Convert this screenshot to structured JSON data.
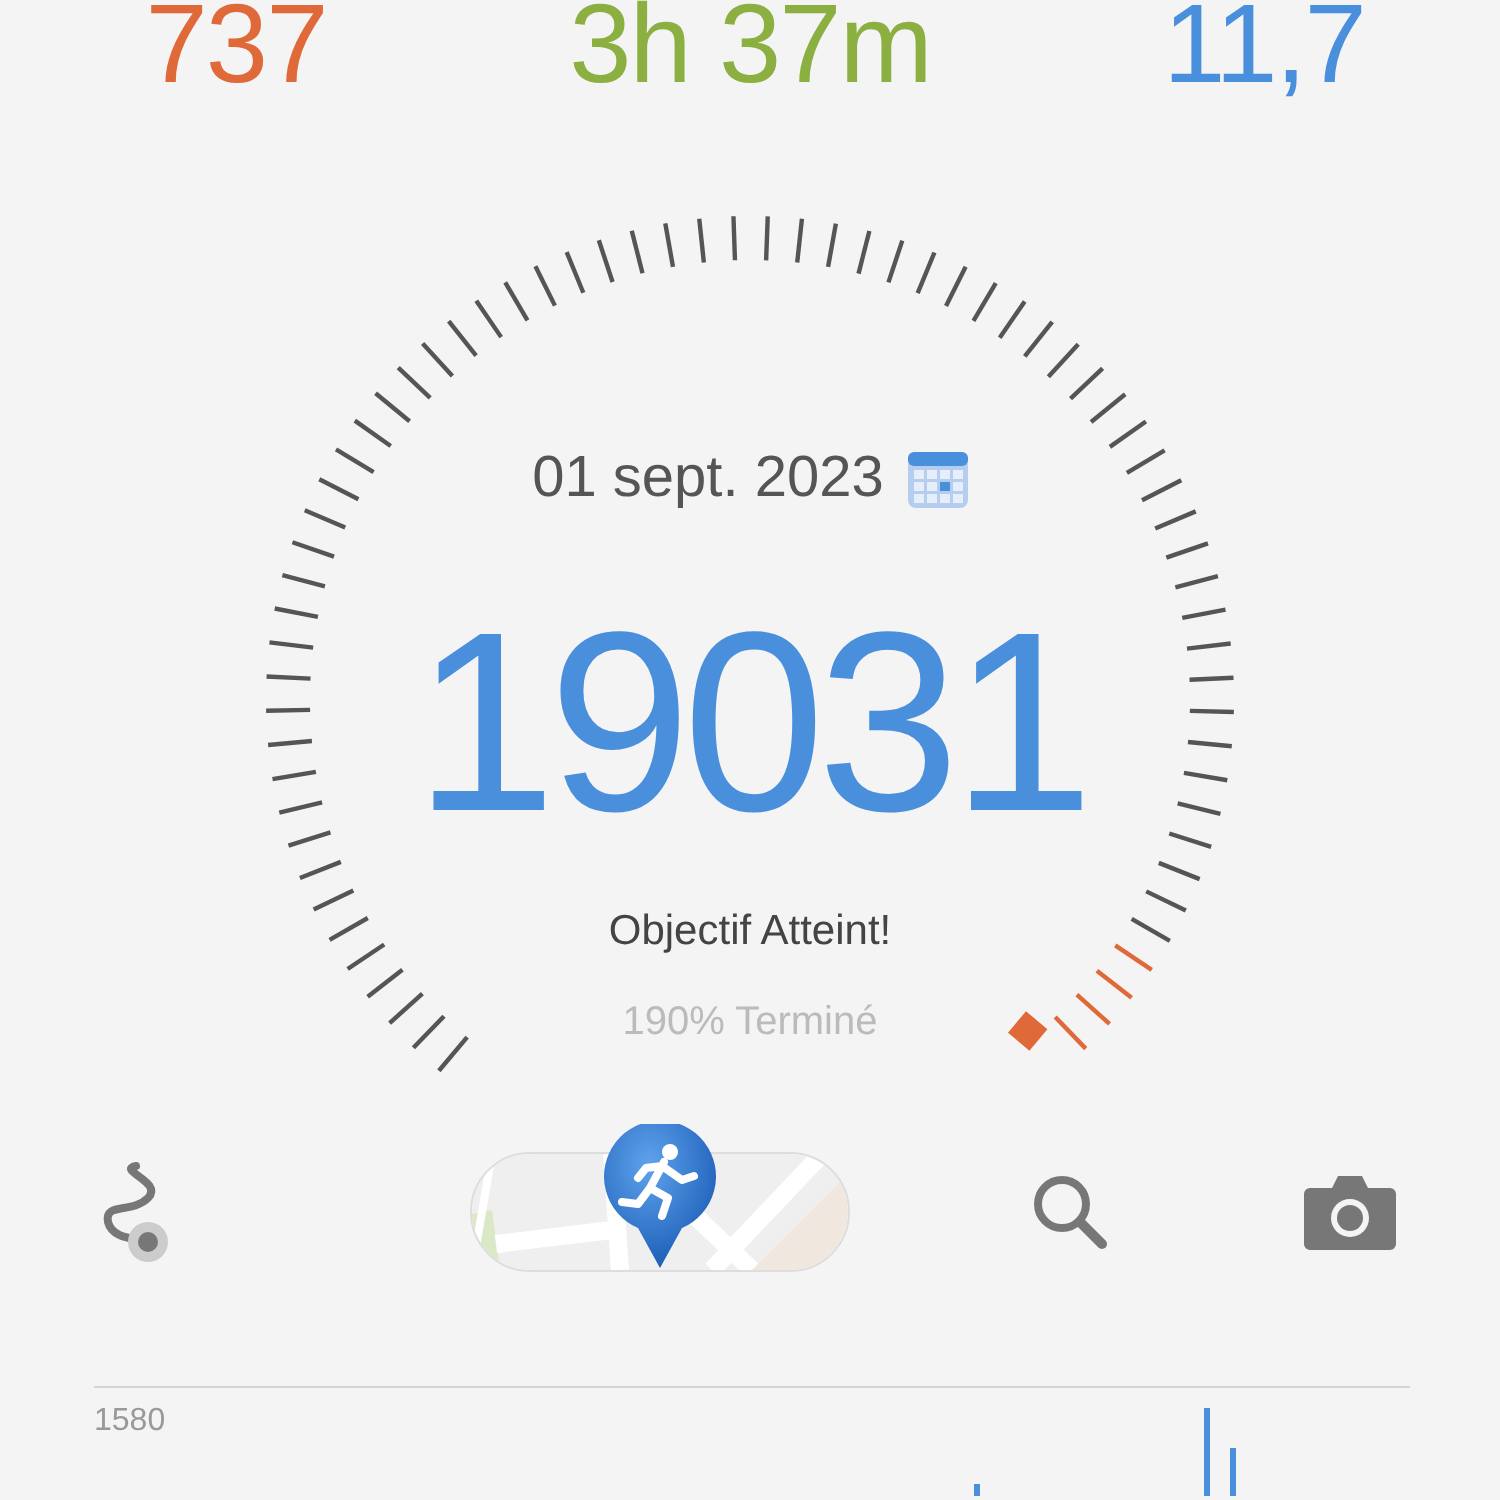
{
  "stats": [
    {
      "value": "737",
      "color": "#e0693a"
    },
    {
      "value": "3h 37m",
      "color": "#8bb041"
    },
    {
      "value": "11,7",
      "color": "#4a8fdc"
    }
  ],
  "gauge": {
    "date": "01 sept. 2023",
    "steps": "19031",
    "status": "Objectif Atteint!",
    "progress": "190% Terminé"
  },
  "chart": {
    "y_max_label": "1580"
  }
}
